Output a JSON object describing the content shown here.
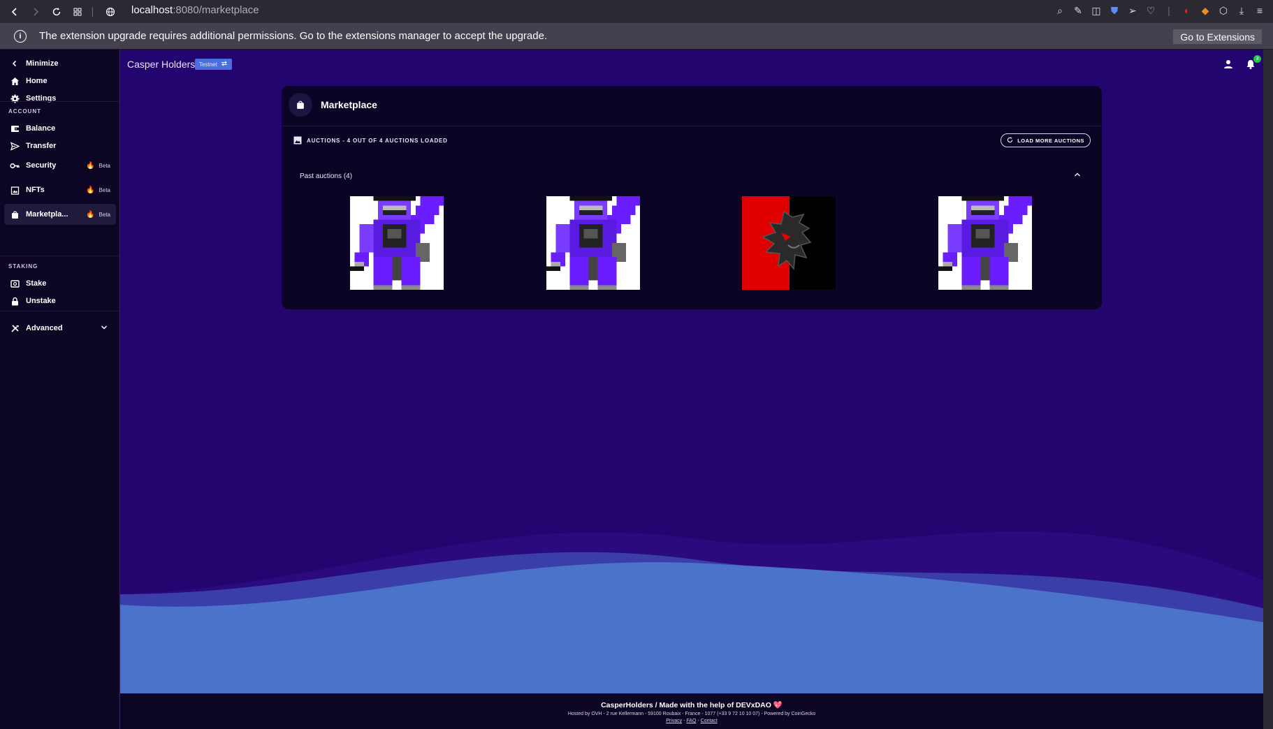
{
  "browser": {
    "url_host": "localhost",
    "url_path": ":8080/marketplace"
  },
  "notice": {
    "message": "The extension upgrade requires additional permissions. Go to the extensions manager to accept the upgrade.",
    "button": "Go to Extensions"
  },
  "sidebar": {
    "minimize": "Minimize",
    "home": "Home",
    "settings": "Settings",
    "account_section": "ACCOUNT",
    "balance": "Balance",
    "transfer": "Transfer",
    "security": "Security",
    "nfts": "NFTs",
    "marketplace": "Marketpla...",
    "beta": "Beta",
    "staking_section": "STAKING",
    "stake": "Stake",
    "unstake": "Unstake",
    "advanced": "Advanced"
  },
  "header": {
    "app_title": "Casper Holders",
    "network_badge": "Testnet",
    "notification_count": "3"
  },
  "marketplace": {
    "title": "Marketplace",
    "auctions_status": "AUCTIONS - 4 OUT OF 4 AUCTIONS LOADED",
    "load_more": "LOAD MORE AUCTIONS",
    "past_auctions": "Past auctions (4)",
    "nfts": [
      {
        "kind": "purple-knight"
      },
      {
        "kind": "purple-knight"
      },
      {
        "kind": "red-demon"
      },
      {
        "kind": "purple-knight"
      }
    ]
  },
  "footer": {
    "credits": "CasperHolders / Made with the help of DEVxDAO 💖",
    "hosting": "Hosted by OVH - 2 rue Kellermann - 59100 Roubaix - France - 1077 (+33 9 72 10 10 07) - Powered by CoinGecko",
    "privacy": "Privacy",
    "faq": "FAQ",
    "contact": "Contact"
  },
  "colors": {
    "main_bg": "#23056f",
    "sidebar_bg": "#0d0524",
    "card_bg": "#0b0424",
    "wave_light": "#4a73c9",
    "badge": "#4b6fe0"
  }
}
